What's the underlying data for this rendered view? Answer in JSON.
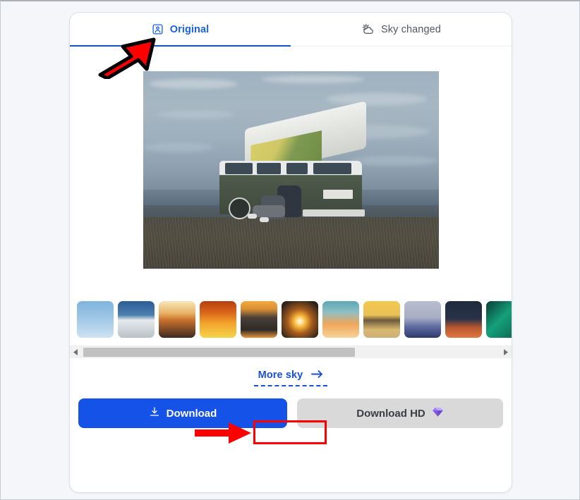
{
  "app": {
    "background_color": "#f5f6fa",
    "card_color": "#ffffff"
  },
  "tabs": [
    {
      "id": "original",
      "label": "Original",
      "icon": "portrait-person-icon",
      "active": true,
      "color": "#1a62e8"
    },
    {
      "id": "sky-changed",
      "label": "Sky changed",
      "icon": "sun-behind-cloud-icon",
      "active": false,
      "color": "#535763"
    }
  ],
  "preview": {
    "alt": "Couple sitting on the grass leaning against a green and white VW camper van with a raised pop-top roof, ocean and dusk sky in the background",
    "width": "419",
    "height": "280"
  },
  "sky_thumbnails": [
    {
      "index": 1,
      "name": "blue-sky-wispy-clouds",
      "colors": [
        "#9ec6e6",
        "#cfe2f2",
        "#7fb4dd"
      ]
    },
    {
      "index": 2,
      "name": "cumulus-clouds-deep-blue",
      "colors": [
        "#2b5d97",
        "#e6eaec",
        "#b9c2c8"
      ]
    },
    {
      "index": 3,
      "name": "sunrise-over-water",
      "colors": [
        "#f7e6b8",
        "#c9702b",
        "#3b2a23"
      ]
    },
    {
      "index": 4,
      "name": "orange-sunset-clouds",
      "colors": [
        "#b5400f",
        "#f2a42a",
        "#f6d44a"
      ]
    },
    {
      "index": 5,
      "name": "dark-clouds-golden-horizon",
      "colors": [
        "#f4a93c",
        "#4a4038",
        "#2e2a27"
      ]
    },
    {
      "index": 6,
      "name": "sun-burst-horizon",
      "colors": [
        "#2a2118",
        "#f6b436",
        "#fdf0c0"
      ]
    },
    {
      "index": 7,
      "name": "teal-sky-orange-clouds",
      "colors": [
        "#5aa7b4",
        "#f0a65a",
        "#f7d39a"
      ]
    },
    {
      "index": 8,
      "name": "yellow-gradient-dusk",
      "colors": [
        "#f2c94c",
        "#6d5a3c",
        "#d9b870"
      ]
    },
    {
      "index": 9,
      "name": "moonlit-blue-mountain-clouds",
      "colors": [
        "#b9bdd0",
        "#5e6aa2",
        "#2f3a6b"
      ]
    },
    {
      "index": 10,
      "name": "night-sky-red-moon-clouds",
      "colors": [
        "#202a3c",
        "#b9572f",
        "#e07840"
      ]
    },
    {
      "index": 11,
      "name": "green-aurora-sky",
      "colors": [
        "#0d5a4a",
        "#14a07a",
        "#0a3c36"
      ]
    }
  ],
  "scrollbar": {
    "left_arrow_icon": "triangle-left-icon",
    "right_arrow_icon": "triangle-right-icon",
    "thumb_width_percent": "65"
  },
  "more_sky": {
    "label": "More sky",
    "arrow_icon": "arrow-right-icon",
    "color": "#1a4fd6"
  },
  "actions": {
    "download": {
      "label": "Download",
      "icon": "download-icon",
      "color": "#1552e8",
      "text_color": "#ffffff"
    },
    "download_hd": {
      "label": "Download HD",
      "icon": "gem-icon",
      "color": "#d9d9d9",
      "text_color": "#3a3d44"
    }
  },
  "annotations": {
    "color": "#fe0000",
    "arrow_to_original_tab": "red-arrow-pointing-up-right",
    "arrow_to_more_sky": "red-arrow-pointing-right",
    "box_around_more_sky": "red-rectangle-highlight"
  }
}
